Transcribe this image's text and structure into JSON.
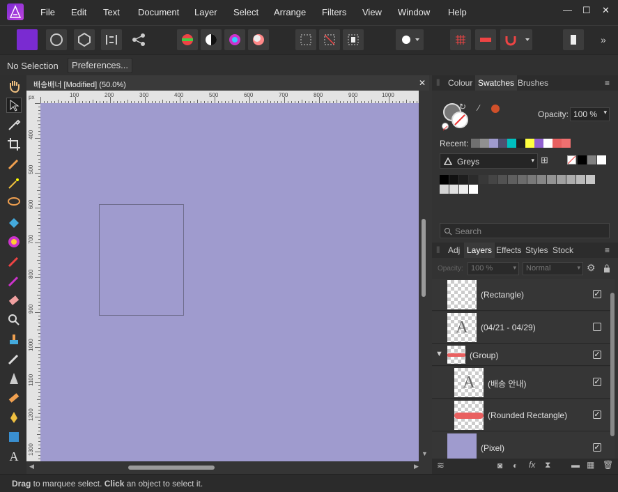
{
  "menu": [
    "File",
    "Edit",
    "Text",
    "Document",
    "Layer",
    "Select",
    "Arrange",
    "Filters",
    "View",
    "Window",
    "Help"
  ],
  "window_controls": {
    "minimize": "—",
    "maximize": "☐",
    "close": "✕"
  },
  "context": {
    "selection": "No Selection",
    "preferences": "Preferences..."
  },
  "document": {
    "tab_title": "배송배너 [Modified] (50.0%)",
    "close": "✕",
    "ruler_unit": "px"
  },
  "hruler_labels": [
    "100",
    "200",
    "300",
    "400",
    "500",
    "600",
    "700",
    "800",
    "900",
    "1000"
  ],
  "vruler_labels": [
    "400",
    "500",
    "600",
    "700",
    "800",
    "900",
    "1000",
    "1100",
    "1200",
    "1300"
  ],
  "colors": {
    "canvas": "#9f9bce",
    "accent_purple": "#8a5bd6",
    "highlight_red": "#e96060"
  },
  "colour_panel": {
    "tabs": [
      "Colour",
      "Swatches",
      "Brushes"
    ],
    "active_tab": "Swatches",
    "opacity_label": "Opacity:",
    "opacity_value": "100 %",
    "recent_label": "Recent:",
    "recent_swatches": [
      "#707070",
      "#909090",
      "#9f9bce",
      "#505070",
      "#00c0c0",
      "#202020",
      "#ffff40",
      "#9060d0",
      "#ffffff",
      "#e86060",
      "#f07070"
    ],
    "palette_name": "Greys",
    "greys": [
      "#000000",
      "#111111",
      "#1e1e1e",
      "#2b2b2b",
      "#383838",
      "#454545",
      "#525252",
      "#5f5f5f",
      "#6c6c6c",
      "#797979",
      "#868686",
      "#939393",
      "#a0a0a0",
      "#adadad",
      "#bababa",
      "#c7c7c7",
      "#d4d4d4",
      "#e1e1e1",
      "#eeeeee",
      "#ffffff"
    ],
    "search_placeholder": "Search"
  },
  "layers_panel": {
    "tabs": [
      "Adj",
      "Layers",
      "Effects",
      "Styles",
      "Stock"
    ],
    "active_tab": "Layers",
    "opacity_label": "Opacity:",
    "opacity_value": "100 %",
    "blend_mode": "Normal",
    "layers": [
      {
        "name": "(Rectangle)",
        "checked": true
      },
      {
        "name": "(04/21 - 04/29)",
        "checked": false
      },
      {
        "name": "(Group)",
        "checked": true
      },
      {
        "name": "(배송 안내)",
        "checked": true
      },
      {
        "name": "(Rounded Rectangle)",
        "checked": true
      },
      {
        "name": "(Pixel)",
        "checked": true
      }
    ]
  },
  "status": {
    "drag": "Drag",
    "text1": " to marquee select. ",
    "click": "Click",
    "text2": " an object to select it."
  }
}
